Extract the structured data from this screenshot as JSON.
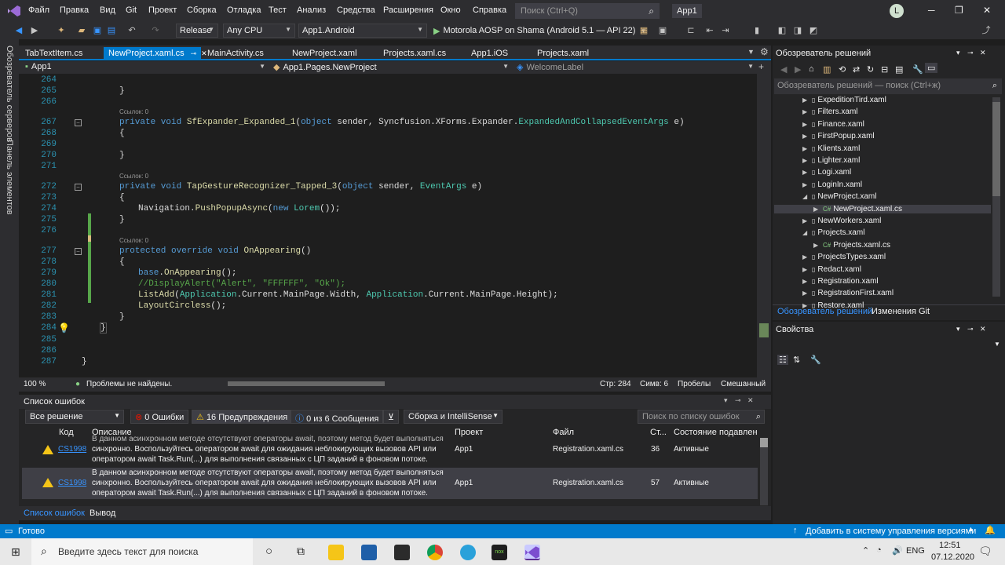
{
  "menubar": {
    "items": [
      "Файл",
      "Правка",
      "Вид",
      "Git",
      "Проект",
      "Сборка",
      "Отладка",
      "Тест",
      "Анализ",
      "Средства",
      "Расширения",
      "Окно",
      "Справка"
    ],
    "search_placeholder": "Поиск (Ctrl+Q)",
    "solution_name": "App1",
    "avatar_initial": "L"
  },
  "toolbar": {
    "config": "Release",
    "platform": "Any CPU",
    "startup_project": "App1.Android",
    "run_target": "Motorola AOSP on Shama (Android 5.1 — API 22)"
  },
  "left_strip": {
    "server_explorer": "Обозреватель серверов",
    "toolbox": "Панель элементов"
  },
  "editor_tabs": [
    {
      "label": "TabTextItem.cs",
      "active": false
    },
    {
      "label": "NewProject.xaml.cs",
      "active": true
    },
    {
      "label": "MainActivity.cs",
      "active": false
    },
    {
      "label": "NewProject.xaml",
      "active": false
    },
    {
      "label": "Projects.xaml.cs",
      "active": false
    },
    {
      "label": "App1.iOS",
      "active": false
    },
    {
      "label": "Projects.xaml",
      "active": false
    }
  ],
  "navbar": {
    "project": "App1",
    "type": "App1.Pages.NewProject",
    "member": "WelcomeLabel"
  },
  "code": {
    "lines": [
      "264",
      "265",
      "266",
      "267",
      "268",
      "269",
      "270",
      "271",
      "272",
      "273",
      "274",
      "275",
      "276",
      "277",
      "278",
      "279",
      "280",
      "281",
      "282",
      "283",
      "284",
      "285",
      "286",
      "287"
    ],
    "ref_label": "Ссылок: 0",
    "l265": "}",
    "l267_kw": "private void ",
    "l267_fn": "SfExpander_Expanded_1",
    "l267_a": "(",
    "l267_kw2": "object",
    "l267_b": " sender, Syncfusion.XForms.Expander.",
    "l267_ty": "ExpandedAndCollapsedEventArgs",
    "l267_c": " e)",
    "l268": "{",
    "l270": "}",
    "l272_kw": "private void ",
    "l272_fn": "TapGestureRecognizer_Tapped_3",
    "l272_a": "(",
    "l272_kw2": "object",
    "l272_b": " sender, ",
    "l272_ty": "EventArgs",
    "l272_c": " e)",
    "l273": "{",
    "l274_a": "Navigation.",
    "l274_fn": "PushPopupAsync",
    "l274_b": "(",
    "l274_kw": "new",
    "l274_c": " ",
    "l274_ty": "Lorem",
    "l274_d": "());",
    "l275": "}",
    "l277_kw": "protected override void ",
    "l277_fn": "OnAppearing",
    "l277_a": "()",
    "l278": "{",
    "l279_kw": "base",
    "l279_a": ".",
    "l279_fn": "OnAppearing",
    "l279_b": "();",
    "l280": "//DisplayAlert(\"Alert\", \"FFFFFF\", \"Ok\");",
    "l281_fn": "ListAdd",
    "l281_a": "(",
    "l281_ty1": "Application",
    "l281_b": ".Current.MainPage.Width, ",
    "l281_ty2": "Application",
    "l281_c": ".Current.MainPage.Height);",
    "l282_fn": "LayoutCircless",
    "l282_a": "();",
    "l283": "}",
    "l284": "}",
    "l287": "}"
  },
  "editor_status": {
    "zoom": "100 %",
    "issues": "Проблемы не найдены.",
    "line": "Стр: 284",
    "col": "Симв: 6",
    "spaces": "Пробелы",
    "eol": "Смешанный"
  },
  "error_list": {
    "title": "Список ошибок",
    "scope": "Все решение",
    "errors": "0 Ошибки",
    "warnings": "16 Предупреждения",
    "messages": "0 из 6 Сообщения",
    "build_filter": "Сборка и IntelliSense",
    "search_placeholder": "Поиск по списку ошибок",
    "headers": {
      "code": "Код",
      "desc": "Описание",
      "project": "Проект",
      "file": "Файл",
      "line": "Ст...",
      "state": "Состояние подавлен"
    },
    "rows": [
      {
        "code": "CS1998",
        "desc_top": "В данном асинхронном методе отсутствуют операторы await, поэтому метод будет выполняться",
        "desc1": "синхронно. Воспользуйтесь оператором await для ожидания неблокирующих вызовов API или",
        "desc2": "оператором await Task.Run(...) для выполнения связанных с ЦП заданий в фоновом потоке.",
        "project": "App1",
        "file": "Registration.xaml.cs",
        "line": "36",
        "state": "Активные"
      },
      {
        "code": "CS1998",
        "desc_top": "В данном асинхронном методе отсутствуют операторы await, поэтому метод будет выполняться",
        "desc1": "синхронно. Воспользуйтесь оператором await для ожидания неблокирующих вызовов API или",
        "desc2": "оператором await Task.Run(...) для выполнения связанных с ЦП заданий в фоновом потоке.",
        "project": "App1",
        "file": "Registration.xaml.cs",
        "line": "57",
        "state": "Активные"
      }
    ],
    "tab_errors": "Список ошибок",
    "tab_output": "Вывод"
  },
  "status": {
    "ready": "Готово",
    "vcs": "Добавить в систему управления версиями"
  },
  "solution_explorer": {
    "title": "Обозреватель решений",
    "search_placeholder": "Обозреватель решений — поиск (Ctrl+ж)",
    "items": [
      {
        "label": "ExpeditionTird.xaml",
        "indent": 0,
        "open": false,
        "cs": false
      },
      {
        "label": "Filters.xaml",
        "indent": 0,
        "open": false,
        "cs": false
      },
      {
        "label": "Finance.xaml",
        "indent": 0,
        "open": false,
        "cs": false
      },
      {
        "label": "FirstPopup.xaml",
        "indent": 0,
        "open": false,
        "cs": false
      },
      {
        "label": "Klients.xaml",
        "indent": 0,
        "open": false,
        "cs": false
      },
      {
        "label": "Lighter.xaml",
        "indent": 0,
        "open": false,
        "cs": false
      },
      {
        "label": "Logi.xaml",
        "indent": 0,
        "open": false,
        "cs": false
      },
      {
        "label": "LoginIn.xaml",
        "indent": 0,
        "open": false,
        "cs": false
      },
      {
        "label": "NewProject.xaml",
        "indent": 0,
        "open": true,
        "cs": false
      },
      {
        "label": "NewProject.xaml.cs",
        "indent": 1,
        "open": false,
        "cs": true
      },
      {
        "label": "NewWorkers.xaml",
        "indent": 0,
        "open": false,
        "cs": false
      },
      {
        "label": "Projects.xaml",
        "indent": 0,
        "open": true,
        "cs": false
      },
      {
        "label": "Projects.xaml.cs",
        "indent": 1,
        "open": false,
        "cs": true
      },
      {
        "label": "ProjectsTypes.xaml",
        "indent": 0,
        "open": false,
        "cs": false
      },
      {
        "label": "Redact.xaml",
        "indent": 0,
        "open": false,
        "cs": false
      },
      {
        "label": "Registration.xaml",
        "indent": 0,
        "open": false,
        "cs": false
      },
      {
        "label": "RegistrationFirst.xaml",
        "indent": 0,
        "open": false,
        "cs": false
      },
      {
        "label": "Restore.xaml",
        "indent": 0,
        "open": false,
        "cs": false
      }
    ],
    "tab_solution": "Обозреватель решений",
    "tab_git": "Изменения Git"
  },
  "properties": {
    "title": "Свойства"
  },
  "taskbar": {
    "search_placeholder": "Введите здесь текст для поиска",
    "lang": "ENG",
    "time": "12:51",
    "date": "07.12.2020"
  }
}
